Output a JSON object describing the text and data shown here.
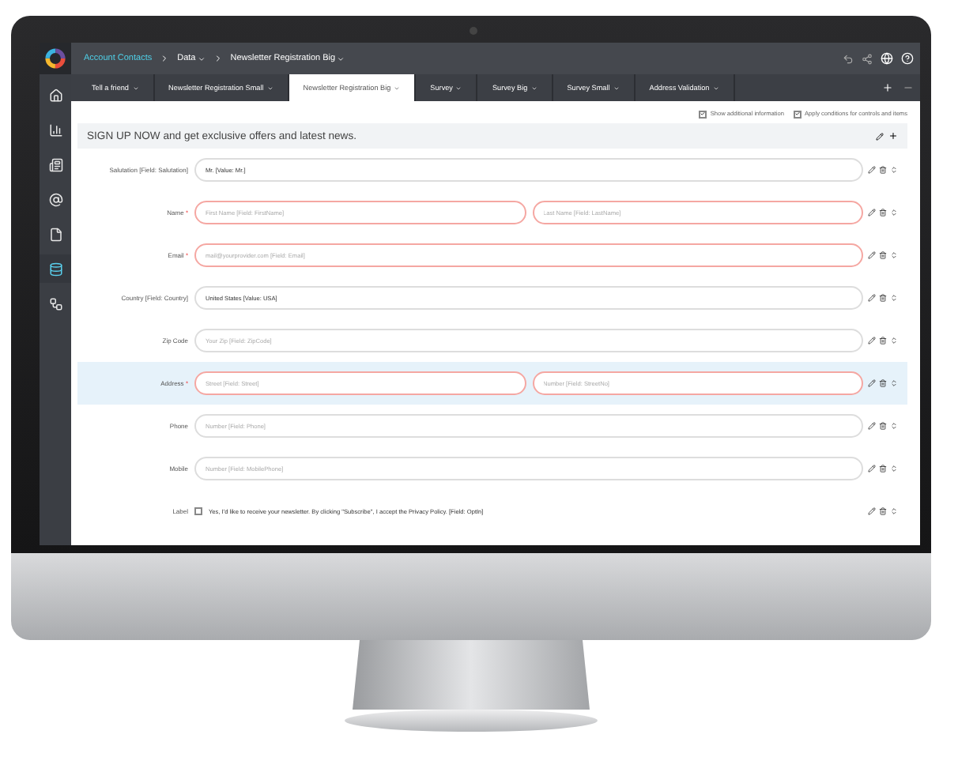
{
  "breadcrumb": [
    {
      "label": "Account Contacts",
      "dropdown": false
    },
    {
      "label": "Data",
      "dropdown": true
    },
    {
      "label": "Newsletter Registration Big",
      "dropdown": true
    }
  ],
  "sidebar": {
    "items": [
      {
        "kind": "home",
        "selected": false
      },
      {
        "kind": "chart",
        "selected": false
      },
      {
        "kind": "list",
        "selected": false
      },
      {
        "kind": "at",
        "selected": false
      },
      {
        "kind": "document",
        "selected": false
      },
      {
        "kind": "database",
        "selected": true
      },
      {
        "kind": "flow",
        "selected": false
      }
    ]
  },
  "tabs": [
    {
      "label": "Tell a friend",
      "selected": false
    },
    {
      "label": "Newsletter Registration Small",
      "selected": false
    },
    {
      "label": "Newsletter Registration Big",
      "selected": true
    },
    {
      "label": "Survey",
      "selected": false
    },
    {
      "label": "Survey Big",
      "selected": false
    },
    {
      "label": "Survey Small",
      "selected": false
    },
    {
      "label": "Address Validation",
      "selected": false
    }
  ],
  "options": [
    {
      "label": "Show additional information",
      "checked": true
    },
    {
      "label": "Apply conditions for controls and items",
      "checked": true
    }
  ],
  "heading": "SIGN UP NOW and get exclusive offers and latest news.",
  "rows": [
    {
      "kind": "fields",
      "label": "Salutation [Field: Salutation]",
      "selected": false,
      "fields": [
        {
          "value": "Mr. [Value: Mr.]"
        }
      ]
    },
    {
      "kind": "fields",
      "label": "Name",
      "mark": "*",
      "required": true,
      "selected": false,
      "fields": [
        {
          "placeholder": "First Name [Field: FirstName]"
        },
        {
          "placeholder": "Last Name [Field: LastName]"
        }
      ]
    },
    {
      "kind": "fields",
      "label": "Email",
      "mark": "*",
      "required": true,
      "selected": false,
      "fields": [
        {
          "placeholder": "mail@yourprovider.com [Field: Email]"
        }
      ]
    },
    {
      "kind": "fields",
      "label": "Country [Field: Country]",
      "selected": false,
      "fields": [
        {
          "value": "United States [Value: USA]"
        }
      ]
    },
    {
      "kind": "fields",
      "label": "Zip Code",
      "selected": false,
      "fields": [
        {
          "placeholder": "Your Zip [Field: ZipCode]"
        }
      ]
    },
    {
      "kind": "fields",
      "label": "Address",
      "mark": "*",
      "required": true,
      "selected": true,
      "fields": [
        {
          "placeholder": "Street [Field: Street]"
        },
        {
          "placeholder": "Number [Field: StreetNo]"
        }
      ]
    },
    {
      "kind": "fields",
      "label": "Phone",
      "selected": false,
      "fields": [
        {
          "placeholder": "Number [Field: Phone]"
        }
      ]
    },
    {
      "kind": "fields",
      "label": "Mobile",
      "selected": false,
      "fields": [
        {
          "placeholder": "Number [Field: MobilePhone]"
        }
      ]
    },
    {
      "kind": "checkbox",
      "label": "Label",
      "selected": false,
      "checked": false,
      "text": "Yes, I'd like to receive your newsletter. By clicking \"Subscribe\", I accept the Privacy Policy. [Field: OptIn]"
    }
  ]
}
